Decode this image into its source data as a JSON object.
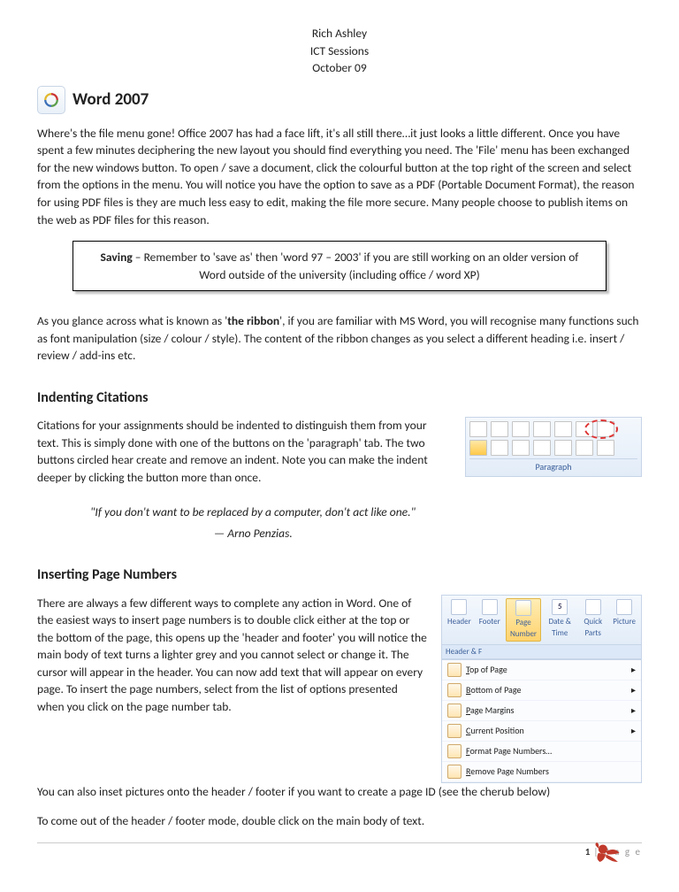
{
  "header": {
    "line1": "Rich Ashley",
    "line2": "ICT Sessions",
    "line3": "October 09"
  },
  "title": "Word 2007",
  "intro": "Where's the file menu gone! Office 2007 has had a face lift, it's all still there…it just looks a little different. Once you have spent a few minutes deciphering the new layout you should find everything you need. The 'File' menu has been exchanged for the new windows button. To open / save a document, click the colourful button at the top right of the screen and select from the options in the menu.  You will notice you have the option to save as a PDF (Portable Document Format), the reason for using PDF files is they are much less easy to edit, making the file more secure. Many people choose to publish items on the web as PDF files for this reason.",
  "callout": {
    "bold": "Saving",
    "rest": " – Remember to 'save as' then 'word 97 – 2003' if you are still working on an older version of Word outside of the university  (including office / word XP)"
  },
  "ribbon_para": {
    "pre": "As you glance across what is known as '",
    "bold": "the ribbon",
    "post": "', if you are familiar with MS Word, you will recognise many functions such as font manipulation (size / colour / style). The content of the ribbon changes as you select a different heading i.e. insert / review / add-ins etc."
  },
  "indent": {
    "heading": "Indenting Citations",
    "para": "Citations for your assignments should be indented to distinguish them from your text. This is simply done with one of the buttons on the 'paragraph' tab. The two buttons circled hear create and remove an indent. Note you can make the indent deeper by clicking the button more than once.",
    "quote": "\"If you don't want to be replaced by a computer, don't act like one.\"",
    "author": "— Arno Penzias.",
    "group_label": "Paragraph"
  },
  "pagenum": {
    "heading": "Inserting Page Numbers",
    "para1": "There are always a few different ways to complete any action in Word.  One of the easiest ways to insert page numbers is to double click either at the top or the bottom of the page, this opens up the 'header and footer' you will notice the main body of text turns a lighter grey and you cannot select or change it. The cursor will appear in the header. You can now add text that will appear on every page. To insert the page numbers, select from the list of options presented when you click on the page number tab.",
    "para2": "You can also inset pictures onto the header / footer if you want to create a page ID (see the cherub below)",
    "para3": "To come out of the header / footer mode, double click on the main body of text.",
    "tabs": {
      "header": "Header",
      "footer": "Footer",
      "page_number": "Page Number",
      "date_time": "Date & Time",
      "quick_parts": "Quick Parts",
      "picture": "Picture",
      "group": "Header & F"
    },
    "menu": {
      "top": "Top of Page",
      "bottom": "Bottom of Page",
      "margins": "Page Margins",
      "current": "Current Position",
      "format": "Format Page Numbers…",
      "remove": "Remove Page Numbers"
    }
  },
  "footer": {
    "num": "1",
    "label": "P a g e"
  }
}
